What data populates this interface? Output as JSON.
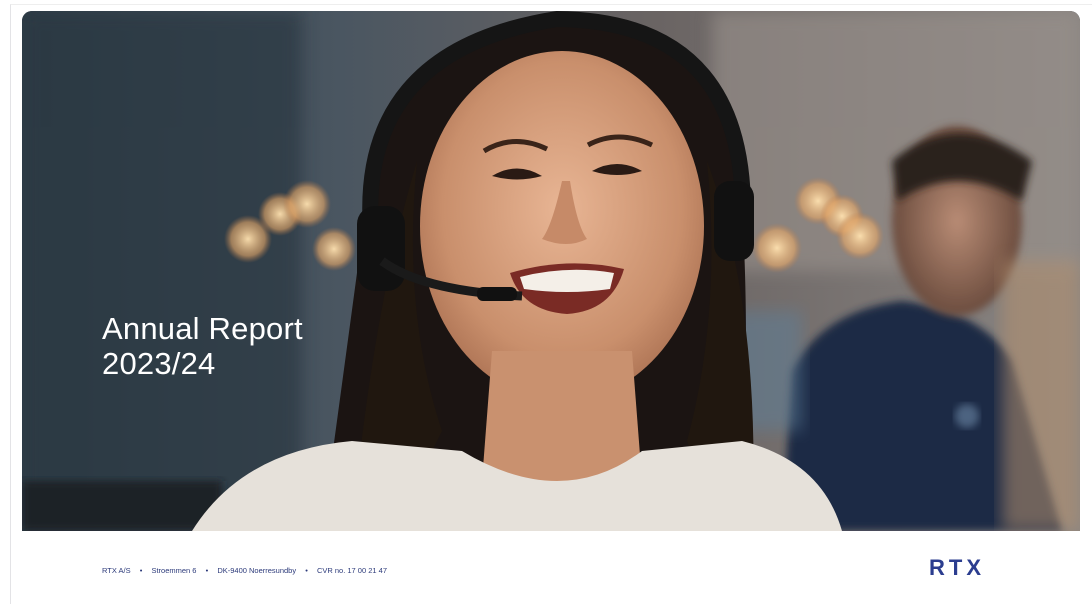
{
  "cover": {
    "title_line1": "Annual Report",
    "title_line2": "2023/24"
  },
  "hero_image": {
    "description_icon": "photo-woman-headset-icon"
  },
  "footer": {
    "company": "RTX A/S",
    "street": "Stroemmen 6",
    "city": "DK-9400 Noerresundby",
    "cvr": "CVR no. 17 00 21 47",
    "separator": "•"
  },
  "logo": {
    "text": "RTX",
    "color": "#2b3d8f"
  }
}
